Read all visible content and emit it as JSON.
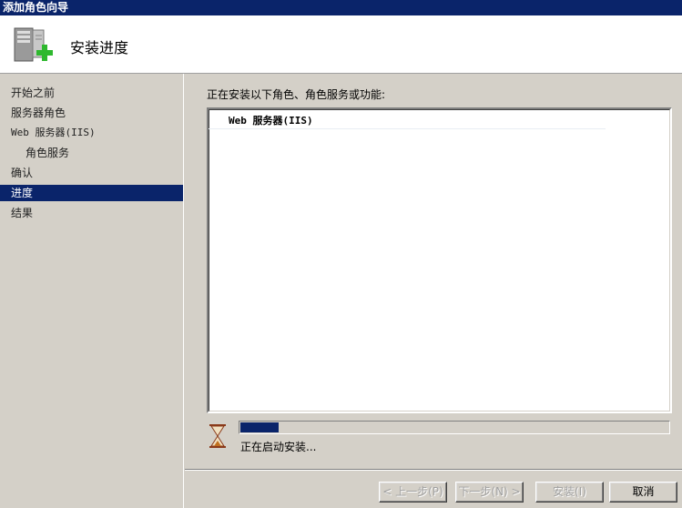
{
  "window": {
    "title": "添加角色向导"
  },
  "header": {
    "title": "安装进度",
    "icon": "server-add-icon"
  },
  "sidebar": {
    "items": [
      {
        "label": "开始之前"
      },
      {
        "label": "服务器角色"
      },
      {
        "label": "Web 服务器(IIS)"
      },
      {
        "label": "角色服务"
      },
      {
        "label": "确认"
      },
      {
        "label": "进度",
        "active": true
      },
      {
        "label": "结果"
      }
    ]
  },
  "main": {
    "intro": "正在安装以下角色、角色服务或功能:",
    "list": [
      {
        "label": "Web 服务器(IIS)"
      }
    ],
    "progress": {
      "fraction": 0.09
    },
    "status": "正在启动安装..."
  },
  "buttons": {
    "back": "< 上一步(P)",
    "next": "下一步(N) >",
    "install": "安装(I)",
    "cancel": "取消"
  },
  "colors": {
    "accent": "#0a246a",
    "face": "#d4d0c8"
  }
}
